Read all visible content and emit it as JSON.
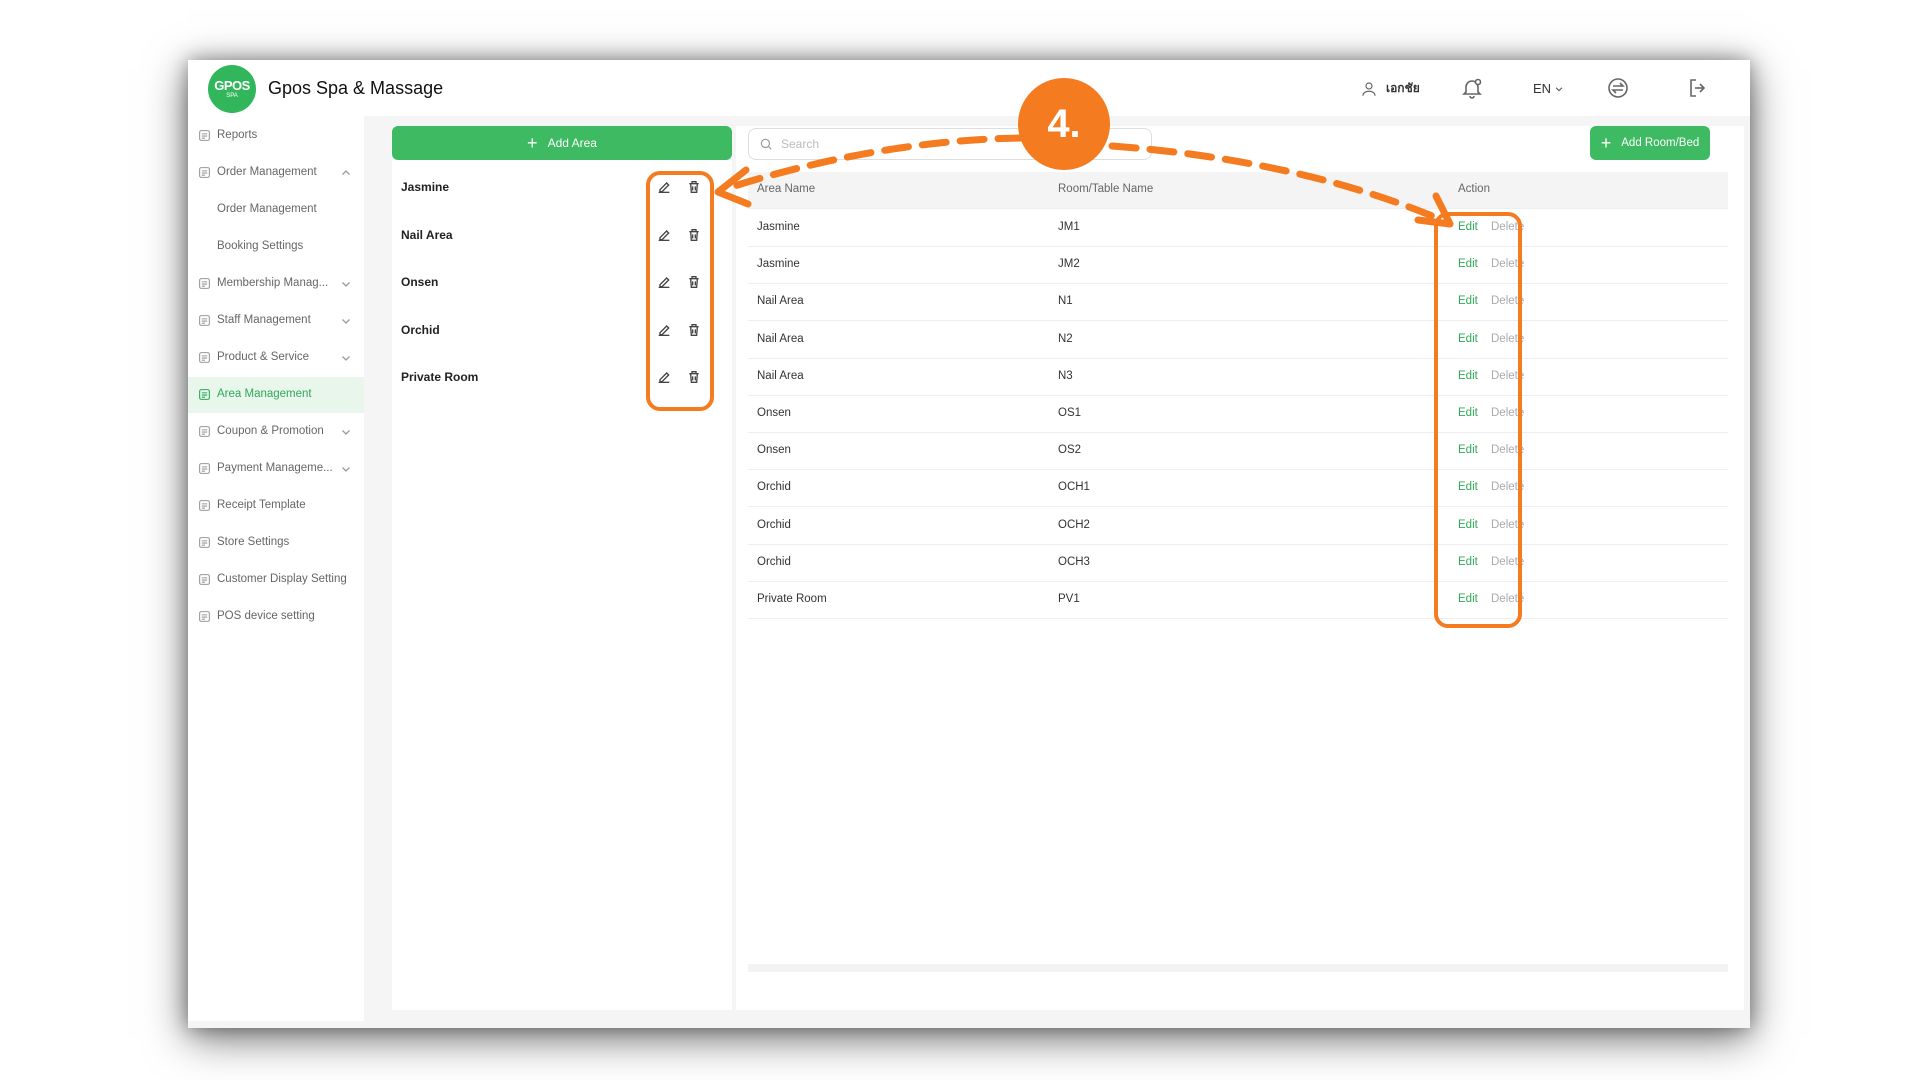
{
  "app": {
    "logo_text": "GPOS",
    "logo_sub": "SPA",
    "title": "Gpos Spa & Massage"
  },
  "header": {
    "user_name": "เอกชัย",
    "language": "EN",
    "icons": [
      "user-icon",
      "bell-icon",
      "chevron-down-icon",
      "sync-icon",
      "logout-icon"
    ]
  },
  "sidebar": {
    "items": [
      {
        "label": "Reports",
        "icon": "report-icon",
        "chevron": ""
      },
      {
        "label": "Order Management",
        "icon": "order-icon",
        "chevron": "up"
      },
      {
        "label": "Order Management",
        "icon": "",
        "chevron": ""
      },
      {
        "label": "Booking Settings",
        "icon": "",
        "chevron": ""
      },
      {
        "label": "Membership Manag...",
        "icon": "membership-icon",
        "chevron": "down"
      },
      {
        "label": "Staff Management",
        "icon": "staff-icon",
        "chevron": "down"
      },
      {
        "label": "Product & Service",
        "icon": "product-icon",
        "chevron": "down"
      },
      {
        "label": "Area Management",
        "icon": "area-icon",
        "chevron": ""
      },
      {
        "label": "Coupon & Promotion",
        "icon": "coupon-icon",
        "chevron": "down"
      },
      {
        "label": "Payment Manageme...",
        "icon": "payment-icon",
        "chevron": "down"
      },
      {
        "label": "Receipt Template",
        "icon": "receipt-icon",
        "chevron": ""
      },
      {
        "label": "Store Settings",
        "icon": "store-icon",
        "chevron": ""
      },
      {
        "label": "Customer Display Setting",
        "icon": "display-icon",
        "chevron": ""
      },
      {
        "label": "POS device setting",
        "icon": "pos-icon",
        "chevron": ""
      }
    ],
    "active": "Area Management"
  },
  "areas": {
    "add_label": "Add Area",
    "items": [
      {
        "name": "Jasmine"
      },
      {
        "name": "Nail Area"
      },
      {
        "name": "Onsen"
      },
      {
        "name": "Orchid"
      },
      {
        "name": "Private Room"
      }
    ]
  },
  "rooms": {
    "search_placeholder": "Search",
    "add_label": "Add Room/Bed",
    "columns": {
      "area": "Area Name",
      "room": "Room/Table Name",
      "action": "Action"
    },
    "edit_label": "Edit",
    "delete_label": "Delete",
    "rows": [
      {
        "area": "Jasmine",
        "room": "JM1"
      },
      {
        "area": "Jasmine",
        "room": "JM2"
      },
      {
        "area": "Nail Area",
        "room": "N1"
      },
      {
        "area": "Nail Area",
        "room": "N2"
      },
      {
        "area": "Nail Area",
        "room": "N3"
      },
      {
        "area": "Onsen",
        "room": "OS1"
      },
      {
        "area": "Onsen",
        "room": "OS2"
      },
      {
        "area": "Orchid",
        "room": "OCH1"
      },
      {
        "area": "Orchid",
        "room": "OCH2"
      },
      {
        "area": "Orchid",
        "room": "OCH3"
      },
      {
        "area": "Private Room",
        "room": "PV1"
      }
    ]
  },
  "annotation": {
    "step": "4.",
    "color": "#f47b20"
  },
  "colors": {
    "brand_green": "#3dba62",
    "edit_green": "#2fa957",
    "active_bg": "#e8f6ec",
    "annotation_orange": "#f47b20"
  }
}
